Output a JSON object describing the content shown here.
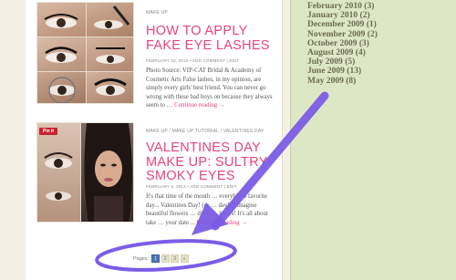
{
  "posts": [
    {
      "category": "MAKE UP",
      "title": "HOW TO APPLY FAKE EYE LASHES",
      "meta": "FEBRUARY 22, 2013 • ADD COMMENT | EDIT",
      "excerpt": "Photo Source: VIP-CAT Bridal & Academy of Cosmetic Arts False lashes, in my opinion, are simply every girls' best friend. You can never go wrong with these bad boys on because they always seem to … ",
      "read_more": "Continue reading →"
    },
    {
      "category": "MAKE UP / MAKE UP TUTORIAL / VALENTINES DAY",
      "title": "VALENTINES DAY MAKE UP: SULTRY SMOKY EYES",
      "meta": "FEBRUARY 5, 2013 • ADD COMMENT | EDIT",
      "excerpt": "It's that time of the month … everybird's favorite day... Valentines Day! (or … day!) I imagine beautiful flowers … dinner... kisses! It's all about take … your date ... ",
      "read_more": "Continue reading →",
      "pin_label": "Pin it"
    }
  ],
  "pagination": {
    "label": "Pages:",
    "pages": [
      "1",
      "2",
      "3",
      "»"
    ],
    "current": "1"
  },
  "sidebar": {
    "archives": [
      {
        "month": "February 2010",
        "count": "(3)"
      },
      {
        "month": "January 2010",
        "count": "(2)"
      },
      {
        "month": "December 2009",
        "count": "(1)"
      },
      {
        "month": "November 2009",
        "count": "(2)"
      },
      {
        "month": "October 2009",
        "count": "(3)"
      },
      {
        "month": "August 2009",
        "count": "(4)"
      },
      {
        "month": "July 2009",
        "count": "(5)"
      },
      {
        "month": "June 2009",
        "count": "(13)"
      },
      {
        "month": "May 2009",
        "count": "(8)"
      }
    ]
  },
  "annotation": {
    "color": "#7b5ce6",
    "shapes": [
      "arrow",
      "ellipse"
    ]
  }
}
